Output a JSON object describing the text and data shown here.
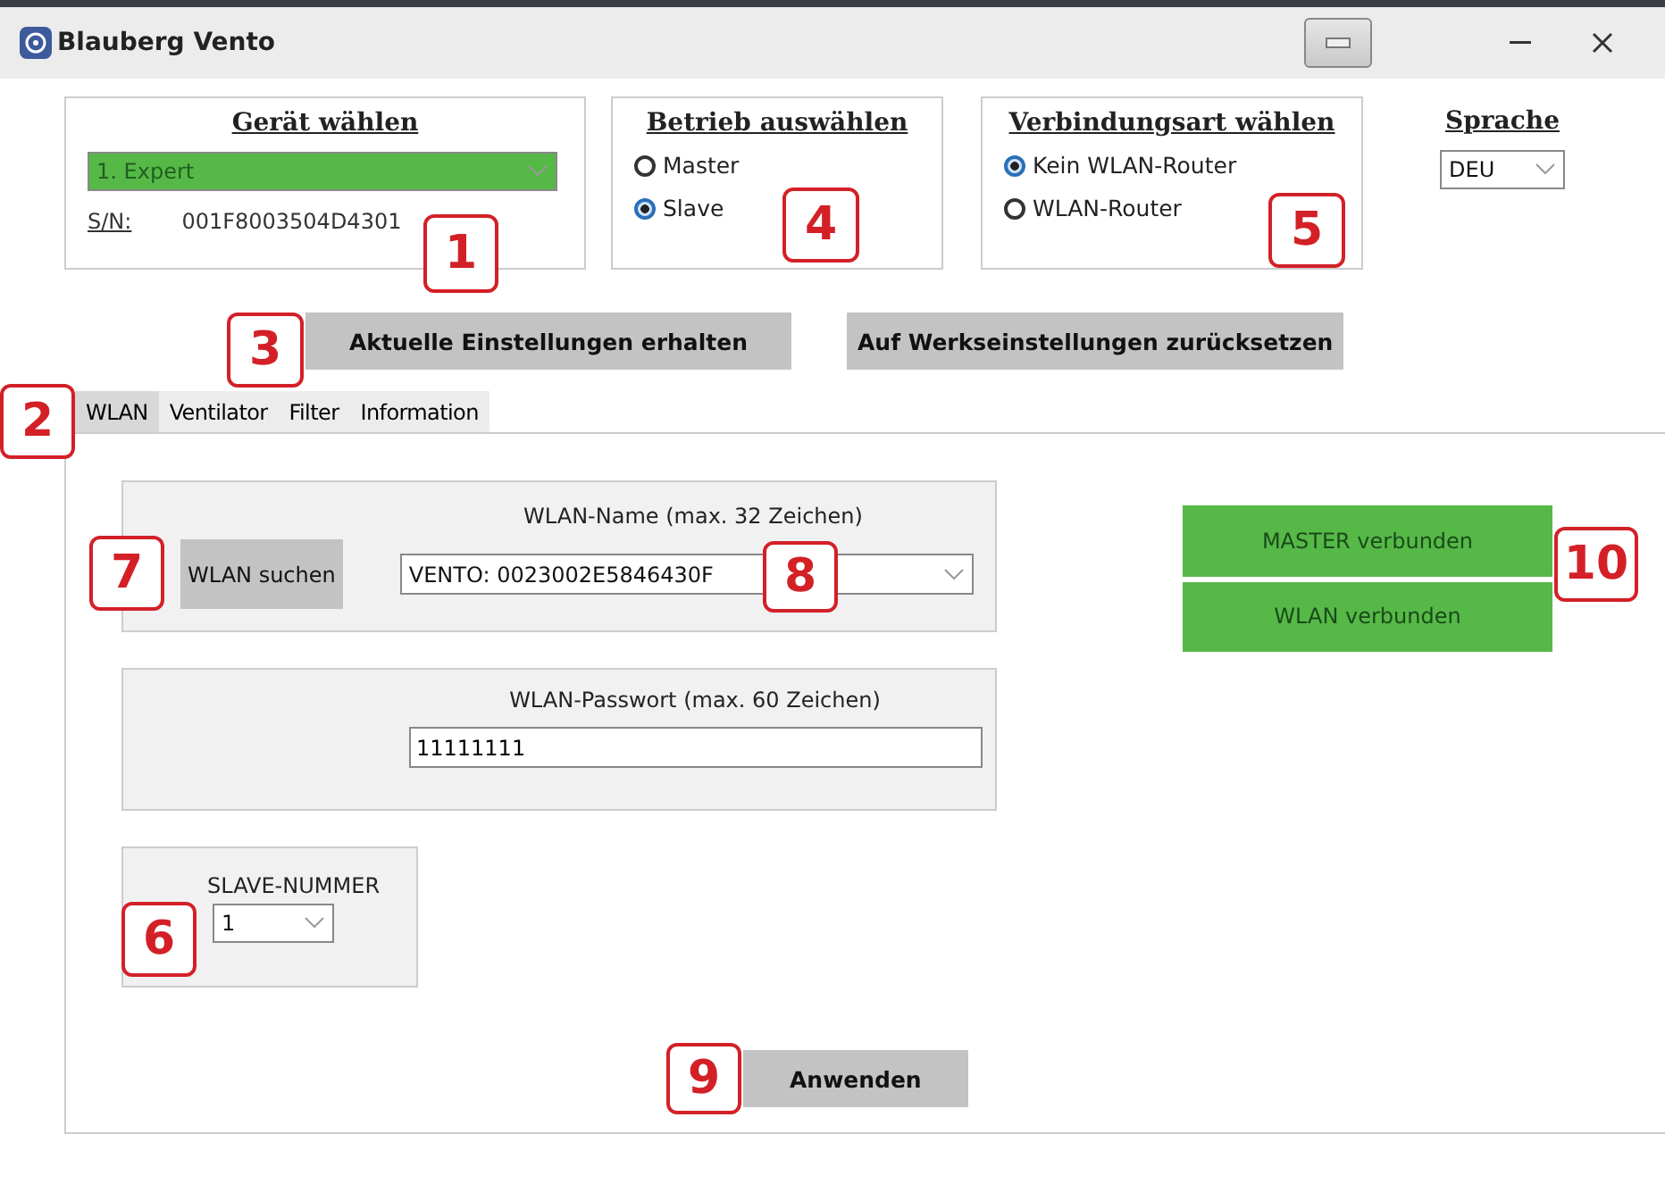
{
  "window": {
    "title": "Blauberg Vento"
  },
  "device_group": {
    "title": "Gerät wählen",
    "device": "1. Expert",
    "sn_label": "S/N:",
    "sn_value": "001F8003504D4301"
  },
  "mode_group": {
    "title": "Betrieb auswählen",
    "options": [
      {
        "label": "Master",
        "selected": false
      },
      {
        "label": "Slave",
        "selected": true
      }
    ]
  },
  "connection_group": {
    "title": "Verbindungsart wählen",
    "options": [
      {
        "label": "Kein WLAN-Router",
        "selected": true
      },
      {
        "label": "WLAN-Router",
        "selected": false
      }
    ]
  },
  "language": {
    "title": "Sprache",
    "value": "DEU"
  },
  "buttons": [
    "Aktuelle Einstellungen erhalten",
    "Auf Werkseinstellungen zurücksetzen"
  ],
  "tabs": [
    {
      "label": "WLAN",
      "selected": true
    },
    {
      "label": "Ventilator",
      "selected": false
    },
    {
      "label": "Filter",
      "selected": false
    },
    {
      "label": "Information",
      "selected": false
    }
  ],
  "wlan": {
    "search_button": "WLAN suchen",
    "name_label": "WLAN-Name (max. 32 Zeichen)",
    "name_value": "VENTO: 0023002E5846430F",
    "password_label": "WLAN-Passwort (max. 60 Zeichen)",
    "password_value": "11111111",
    "slave_label": "SLAVE-NUMMER",
    "slave_value": "1",
    "apply_button": "Anwenden"
  },
  "status": [
    "MASTER verbunden",
    "WLAN verbunden"
  ],
  "callouts": [
    {
      "label": "1"
    },
    {
      "label": "2"
    },
    {
      "label": "3"
    },
    {
      "label": "4"
    },
    {
      "label": "5"
    },
    {
      "label": "6"
    },
    {
      "label": "7"
    },
    {
      "label": "8"
    },
    {
      "label": "9"
    },
    {
      "label": "10"
    }
  ]
}
